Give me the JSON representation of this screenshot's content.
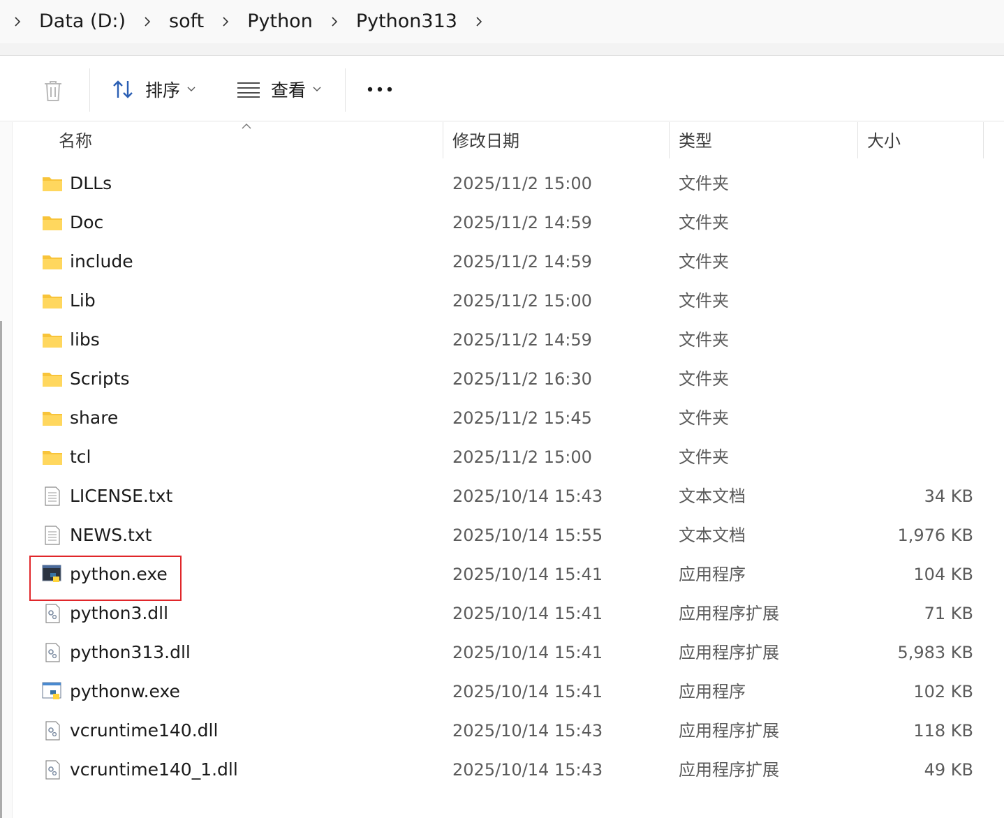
{
  "breadcrumb": {
    "items": [
      "Data (D:)",
      "soft",
      "Python",
      "Python313"
    ]
  },
  "toolbar": {
    "sort_label": "排序",
    "view_label": "查看"
  },
  "columns": {
    "name": "名称",
    "date": "修改日期",
    "type": "类型",
    "size": "大小"
  },
  "files": [
    {
      "name": "DLLs",
      "date": "2025/11/2 15:00",
      "type": "文件夹",
      "size": "",
      "icon": "folder-icon"
    },
    {
      "name": "Doc",
      "date": "2025/11/2 14:59",
      "type": "文件夹",
      "size": "",
      "icon": "folder-icon"
    },
    {
      "name": "include",
      "date": "2025/11/2 14:59",
      "type": "文件夹",
      "size": "",
      "icon": "folder-icon"
    },
    {
      "name": "Lib",
      "date": "2025/11/2 15:00",
      "type": "文件夹",
      "size": "",
      "icon": "folder-icon"
    },
    {
      "name": "libs",
      "date": "2025/11/2 14:59",
      "type": "文件夹",
      "size": "",
      "icon": "folder-icon"
    },
    {
      "name": "Scripts",
      "date": "2025/11/2 16:30",
      "type": "文件夹",
      "size": "",
      "icon": "folder-icon"
    },
    {
      "name": "share",
      "date": "2025/11/2 15:45",
      "type": "文件夹",
      "size": "",
      "icon": "folder-icon"
    },
    {
      "name": "tcl",
      "date": "2025/11/2 15:00",
      "type": "文件夹",
      "size": "",
      "icon": "folder-icon"
    },
    {
      "name": "LICENSE.txt",
      "date": "2025/10/14 15:43",
      "type": "文本文档",
      "size": "34 KB",
      "icon": "text-file-icon"
    },
    {
      "name": "NEWS.txt",
      "date": "2025/10/14 15:55",
      "type": "文本文档",
      "size": "1,976 KB",
      "icon": "text-file-icon"
    },
    {
      "name": "python.exe",
      "date": "2025/10/14 15:41",
      "type": "应用程序",
      "size": "104 KB",
      "icon": "python-console-icon"
    },
    {
      "name": "python3.dll",
      "date": "2025/10/14 15:41",
      "type": "应用程序扩展",
      "size": "71 KB",
      "icon": "dll-file-icon"
    },
    {
      "name": "python313.dll",
      "date": "2025/10/14 15:41",
      "type": "应用程序扩展",
      "size": "5,983 KB",
      "icon": "dll-file-icon"
    },
    {
      "name": "pythonw.exe",
      "date": "2025/10/14 15:41",
      "type": "应用程序",
      "size": "102 KB",
      "icon": "python-window-icon"
    },
    {
      "name": "vcruntime140.dll",
      "date": "2025/10/14 15:43",
      "type": "应用程序扩展",
      "size": "118 KB",
      "icon": "dll-file-icon"
    },
    {
      "name": "vcruntime140_1.dll",
      "date": "2025/10/14 15:43",
      "type": "应用程序扩展",
      "size": "49 KB",
      "icon": "dll-file-icon"
    }
  ],
  "highlighted_file": "python.exe",
  "colors": {
    "folder": "#f8c43a",
    "highlight": "#e0262a",
    "python_blue": "#3772a4",
    "python_yellow": "#ffd43b"
  }
}
